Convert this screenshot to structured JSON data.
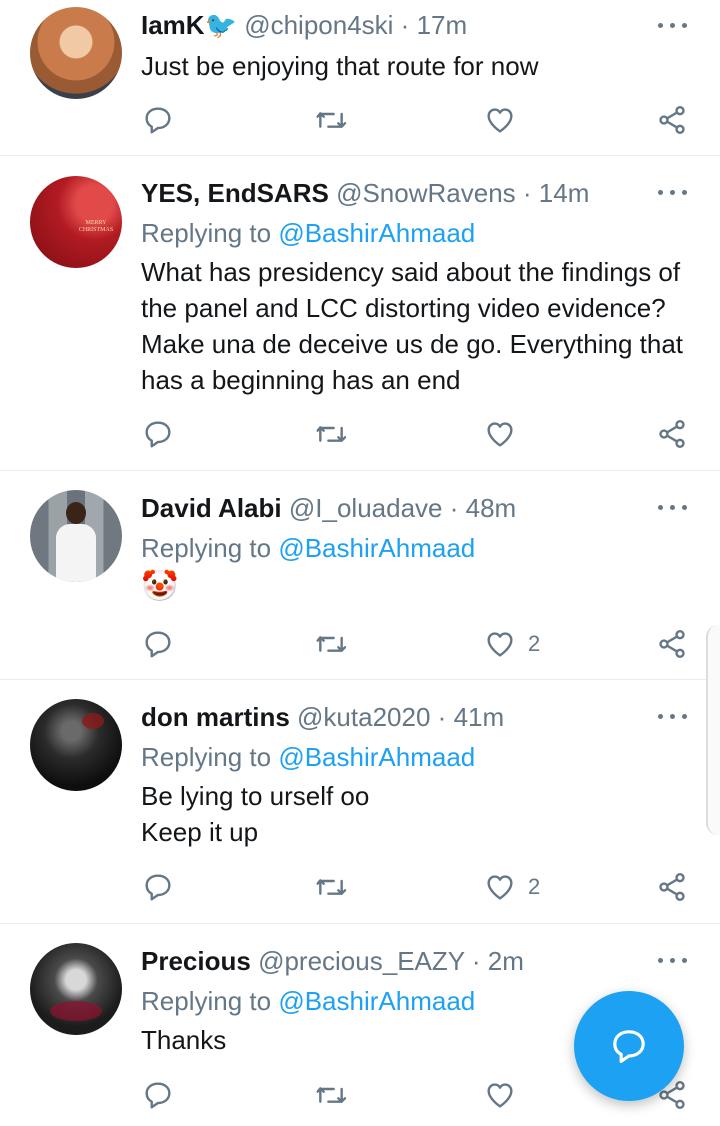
{
  "tweets": [
    {
      "name": "IamK",
      "emoji": "🐦",
      "handle": "@chipon4ski",
      "dot": "·",
      "time": "17m",
      "replying_prefix": "",
      "replying_to": "",
      "text": "Just be enjoying that route for now",
      "likes": ""
    },
    {
      "name": "YES, EndSARS",
      "emoji": "",
      "handle": "@SnowRavens",
      "dot": "·",
      "time": "14m",
      "replying_prefix": "Replying to ",
      "replying_to": "@BashirAhmaad",
      "text": "What has presidency said about the findings of the panel and LCC distorting video evidence? Make una de deceive us de go. Everything that has a beginning has an end",
      "likes": "",
      "avatar_text": "MERRY CHRISTMAS"
    },
    {
      "name": "David Alabi",
      "emoji": "",
      "handle": "@I_oluadave",
      "dot": "·",
      "time": "48m",
      "replying_prefix": "Replying to ",
      "replying_to": "@BashirAhmaad",
      "text": "🤡",
      "likes": "2"
    },
    {
      "name": "don martins",
      "emoji": "",
      "handle": "@kuta2020",
      "dot": "·",
      "time": "41m",
      "replying_prefix": "Replying to ",
      "replying_to": "@BashirAhmaad",
      "text": "Be lying to urself oo\nKeep it up",
      "likes": "2"
    },
    {
      "name": "Precious",
      "emoji": "",
      "handle": "@precious_EAZY",
      "dot": "·",
      "time": "2m",
      "replying_prefix": "Replying to ",
      "replying_to": "@BashirAhmaad",
      "text": "Thanks",
      "likes": ""
    }
  ],
  "icons": {
    "reply": "reply-icon",
    "retweet": "retweet-icon",
    "like": "heart-icon",
    "share": "share-icon",
    "more": "more-icon",
    "compose": "compose-reply-icon"
  },
  "colors": {
    "accent": "#1da1f2",
    "secondary_text": "#657786",
    "divider": "#e6ecf0"
  }
}
